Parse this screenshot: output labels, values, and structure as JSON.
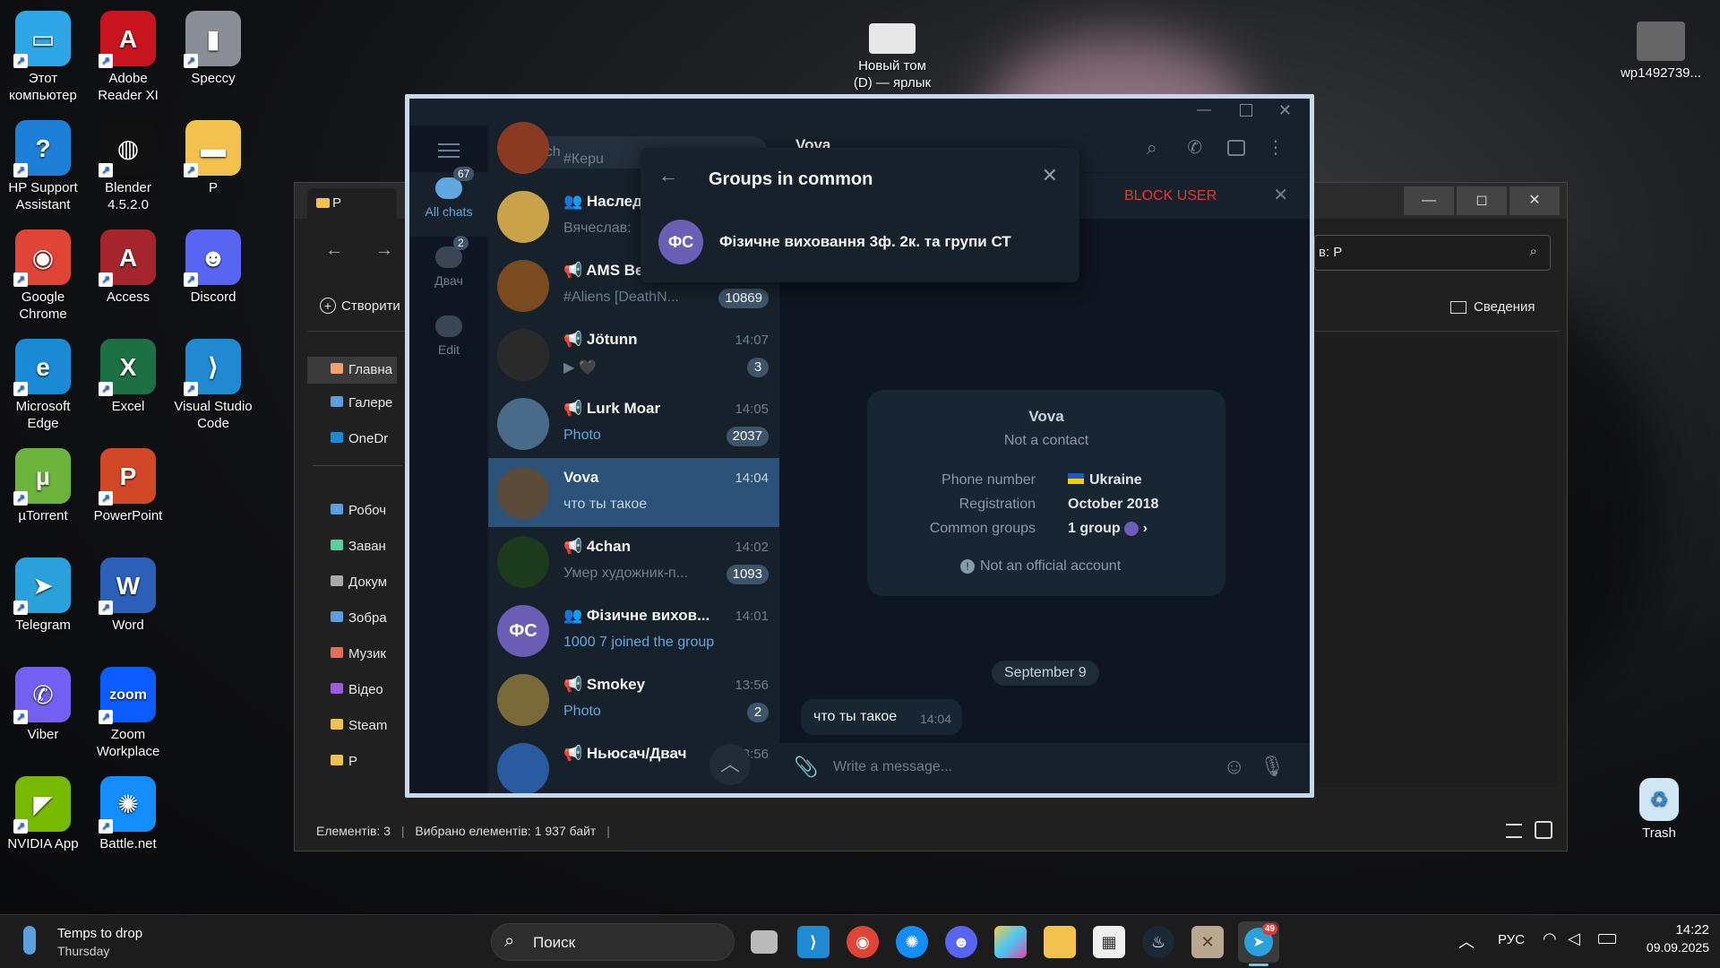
{
  "desktop": {
    "icons": [
      {
        "label": "Этот компьютер",
        "glyph": "▭",
        "color": "#2ea7e8"
      },
      {
        "label": "Adobe Reader XI",
        "glyph": "A",
        "color": "#c8141e"
      },
      {
        "label": "Speccy",
        "glyph": "▮",
        "color": "#8a8f96"
      },
      {
        "label": "HP Support Assistant",
        "glyph": "?",
        "color": "#1e7fd8"
      },
      {
        "label": "Blender 4.5.2.0",
        "glyph": "◍",
        "color": "#111111"
      },
      {
        "label": "P",
        "glyph": "▬",
        "color": "#f2c14e"
      },
      {
        "label": "Google Chrome",
        "glyph": "◉",
        "color": "#e04436"
      },
      {
        "label": "Access",
        "glyph": "A",
        "color": "#a4262c"
      },
      {
        "label": "Discord",
        "glyph": "☻",
        "color": "#5865f2"
      },
      {
        "label": "Microsoft Edge",
        "glyph": "e",
        "color": "#1a8ad4"
      },
      {
        "label": "Excel",
        "glyph": "X",
        "color": "#1d7044"
      },
      {
        "label": "Visual Studio Code",
        "glyph": "⟩",
        "color": "#1f8ad2"
      },
      {
        "label": "µTorrent",
        "glyph": "µ",
        "color": "#6bb33a"
      },
      {
        "label": "PowerPoint",
        "glyph": "P",
        "color": "#d24726"
      },
      {
        "label": "Telegram",
        "glyph": "➤",
        "color": "#2aa1da"
      },
      {
        "label": "Word",
        "glyph": "W",
        "color": "#2b5fb8"
      },
      {
        "label": "Viber",
        "glyph": "✆",
        "color": "#7360f2"
      },
      {
        "label": "Zoom Workplace",
        "glyph": "zoom",
        "color": "#0b5cff"
      },
      {
        "label": "NVIDIA App",
        "glyph": "◤",
        "color": "#76b900"
      },
      {
        "label": "Battle.net",
        "glyph": "✺",
        "color": "#148eff"
      }
    ],
    "top_icons": [
      {
        "label": "Новый том (D) — ярлык"
      },
      {
        "label": "wp1492739..."
      }
    ],
    "trash_label": "Trash"
  },
  "explorer": {
    "title": "P",
    "create_btn": "Створити",
    "search_value": "в: P",
    "details_btn": "Сведения",
    "nav": [
      "Главна",
      "Галере",
      "OneDr",
      "Робоч",
      "Заван",
      "Докум",
      "Зобра",
      "Музик",
      "Відео",
      "Steam",
      "P"
    ],
    "status_items": "Елементів: 3",
    "status_selected": "Вибрано елементів: 1  937 байт",
    "win_min": "—",
    "win_max": "◻",
    "win_close": "✕"
  },
  "telegram": {
    "search_placeholder": "Search",
    "header_name": "Vova",
    "block_user": "BLOCK USER",
    "rail": [
      {
        "label": "All chats",
        "badge": "67"
      },
      {
        "label": "Двач",
        "badge": "2"
      },
      {
        "label": "Edit",
        "badge": ""
      }
    ],
    "chats": [
      {
        "name": "",
        "preview": "#Керu",
        "time": "",
        "badge": "",
        "avatar": "#8a3a22",
        "icon": ""
      },
      {
        "name": "Наслед",
        "preview": "Вячеслав:",
        "time": "",
        "badge": "",
        "avatar": "#c9a24a",
        "icon": "👥"
      },
      {
        "name": "AMS Весь дроп",
        "preview": "#Aliens [DeathN...",
        "time": "14:19",
        "badge": "10869",
        "avatar": "#7a4a20",
        "icon": "📢"
      },
      {
        "name": "Jötunn",
        "preview": "▶ 🖤",
        "time": "14:07",
        "badge": "3",
        "avatar": "#2a2a2a",
        "icon": "📢"
      },
      {
        "name": "Lurk Moar",
        "preview": "Photo",
        "time": "14:05",
        "badge": "2037",
        "avatar": "#4a6a8a",
        "icon": "📢"
      },
      {
        "name": "Vova",
        "preview": "что ты такое",
        "time": "14:04",
        "badge": "",
        "avatar": "#5a4a3a",
        "icon": ""
      },
      {
        "name": "4chan",
        "preview": "Умер художник-п...",
        "time": "14:02",
        "badge": "1093",
        "avatar": "#1c3a1c",
        "icon": "📢"
      },
      {
        "name": "Фізичне вихов...",
        "preview": "1000 7 joined the group via i...",
        "time": "14:01",
        "badge": "",
        "avatar": "#6b5fb5",
        "icon": "👥"
      },
      {
        "name": "Smokey",
        "preview": "Photo",
        "time": "13:56",
        "badge": "2",
        "avatar": "#7a6a3a",
        "icon": "📢"
      },
      {
        "name": "Ньюсач/Двач",
        "preview": "",
        "time": "13:56",
        "badge": "",
        "avatar": "#2a5aa0",
        "icon": "📢"
      }
    ],
    "popup": {
      "title": "Groups in common",
      "group_initials": "ФС",
      "group_name": "Фізичне виховання 3ф. 2к. та групи СТ"
    },
    "profile": {
      "name": "Vova",
      "subtitle": "Not a contact",
      "phone_label": "Phone number",
      "phone_value": "Ukraine",
      "reg_label": "Registration",
      "reg_value": "October 2018",
      "groups_label": "Common groups",
      "groups_value": "1 group",
      "official": "Not an official account"
    },
    "date_chip": "September 9",
    "message": {
      "text": "что ты такое",
      "time": "14:04"
    },
    "input_placeholder": "Write a message...",
    "list_initials": "ФС"
  },
  "taskbar": {
    "weather_title": "Temps to drop",
    "weather_sub": "Thursday",
    "search_label": "Поиск",
    "lang": "РУС",
    "time": "14:22",
    "date": "09.09.2025",
    "telegram_badge": "49"
  }
}
